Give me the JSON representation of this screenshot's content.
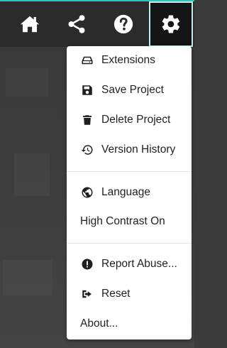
{
  "colors": {
    "accent": "#2fc4b5",
    "toolbar": "#2b2b2b",
    "menu_bg": "#ffffff",
    "text": "#222222"
  },
  "toolbar": {
    "buttons": [
      {
        "icon": "home-icon"
      },
      {
        "icon": "share-icon"
      },
      {
        "icon": "help-icon"
      },
      {
        "icon": "gear-icon",
        "active": true
      }
    ]
  },
  "menu": {
    "extensions": "Extensions",
    "save_project": "Save Project",
    "delete_project": "Delete Project",
    "version_history": "Version History",
    "language": "Language",
    "high_contrast": "High Contrast On",
    "report_abuse": "Report Abuse...",
    "reset": "Reset",
    "about": "About..."
  }
}
